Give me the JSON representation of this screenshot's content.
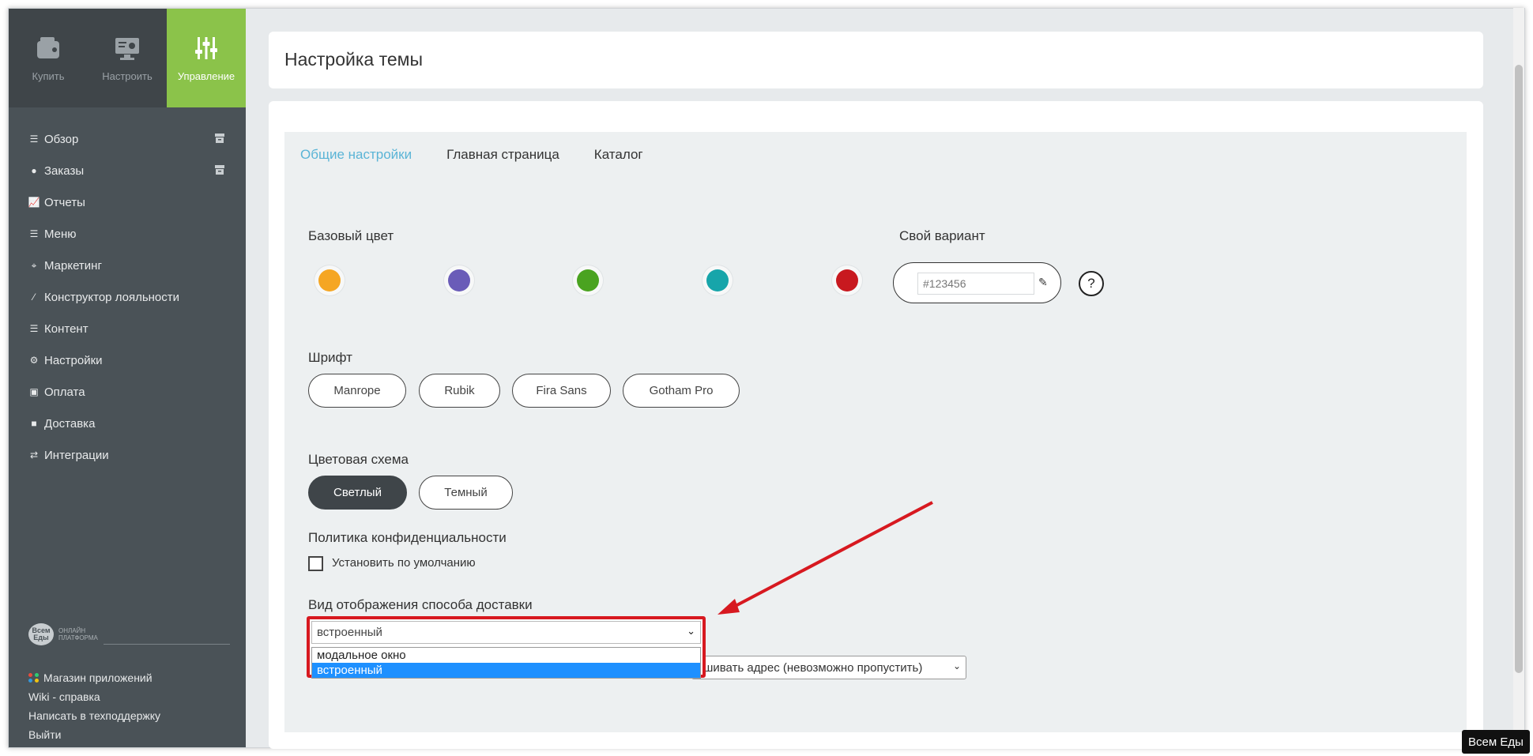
{
  "topnav": [
    {
      "label": "Купить",
      "icon": "wallet-icon"
    },
    {
      "label": "Настроить",
      "icon": "monitor-settings-icon"
    },
    {
      "label": "Управление",
      "icon": "sliders-icon"
    }
  ],
  "menu": [
    {
      "label": "Обзор",
      "icon": "list-icon"
    },
    {
      "label": "Заказы",
      "icon": "circle-icon"
    },
    {
      "label": "Отчеты",
      "icon": "chart-line-icon"
    },
    {
      "label": "Меню",
      "icon": "list-icon"
    },
    {
      "label": "Маркетинг",
      "icon": "crosshair-icon"
    },
    {
      "label": "Конструктор лояльности",
      "icon": "magic-wand-icon"
    },
    {
      "label": "Контент",
      "icon": "list-icon"
    },
    {
      "label": "Настройки",
      "icon": "gear-icon"
    },
    {
      "label": "Оплата",
      "icon": "money-icon"
    },
    {
      "label": "Доставка",
      "icon": "truck-icon"
    },
    {
      "label": "Интеграции",
      "icon": "exchange-icon"
    }
  ],
  "brand": {
    "logo_text": "Всем Еды",
    "caption": "ОНЛАЙН ПЛАТФОРМА"
  },
  "bottom_links": [
    "Магазин приложений",
    "Wiki - справка",
    "Написать в техподдержку",
    "Выйти"
  ],
  "page_title": "Настройка темы",
  "tabs": [
    "Общие настройки",
    "Главная страница",
    "Каталог"
  ],
  "base_color": {
    "label": "Базовый цвет",
    "swatches": [
      "#f5a623",
      "#6a5cb8",
      "#4aa320",
      "#17a5aa",
      "#c8191f"
    ]
  },
  "custom": {
    "label": "Свой вариант",
    "value": "#123456",
    "help": "?"
  },
  "font": {
    "label": "Шрифт",
    "options": [
      "Manrope",
      "Rubik",
      "Fira Sans",
      "Gotham Pro"
    ]
  },
  "scheme": {
    "label": "Цветовая схема",
    "options": [
      "Светлый",
      "Темный"
    ],
    "selected": "Светлый"
  },
  "privacy": {
    "label": "Политика конфиденциальности",
    "checkbox_label": "Установить по умолчанию"
  },
  "delivery": {
    "label": "Вид отображения способа доставки",
    "selected": "встроенный",
    "options": [
      "модальное окно",
      "встроенный"
    ]
  },
  "address_select": {
    "value": "ашивать адрес (невозможно пропустить)"
  },
  "badge": "Всем Еды",
  "colors": {
    "accent_green": "#8bc34a",
    "sidebar": "#4a5257",
    "tab_active": "#5ab4d6",
    "highlight_red": "#d71920"
  }
}
